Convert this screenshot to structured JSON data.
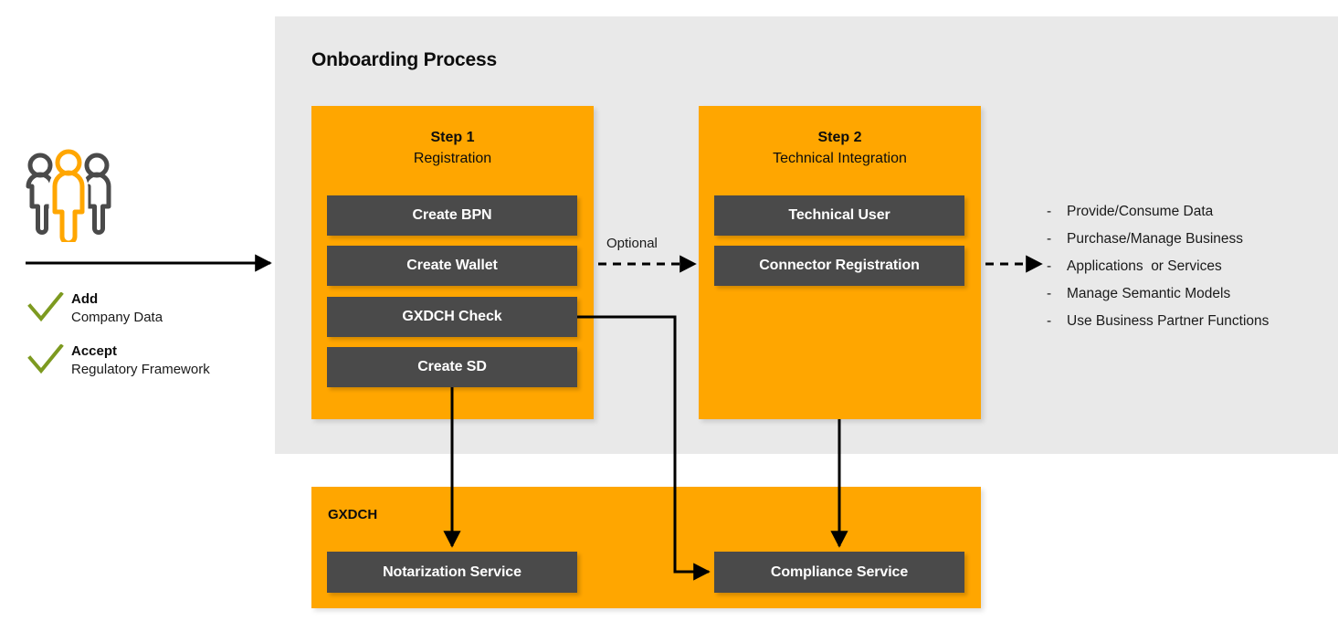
{
  "colors": {
    "panel_gray": "#e9e9e9",
    "orange": "#ffa600",
    "dark_button": "#4a4a4a",
    "check_green": "#7d9a20",
    "arrow_black": "#000000",
    "white": "#ffffff"
  },
  "panel": {
    "title": "Onboarding Process"
  },
  "actor": {
    "icon": "people-group-icon",
    "arrow": "actor-to-process-arrow",
    "checks": [
      {
        "icon": "check-icon",
        "title": "Add",
        "subtitle": "Company Data"
      },
      {
        "icon": "check-icon",
        "title": "Accept",
        "subtitle": "Regulatory Framework"
      }
    ]
  },
  "steps": [
    {
      "id": "step1",
      "title": "Step 1",
      "subtitle": "Registration",
      "buttons": [
        {
          "id": "create-bpn",
          "label": "Create BPN"
        },
        {
          "id": "create-wallet",
          "label": "Create Wallet"
        },
        {
          "id": "gxdch-check",
          "label": "GXDCH Check"
        },
        {
          "id": "create-sd",
          "label": "Create SD"
        }
      ]
    },
    {
      "id": "step2",
      "title": "Step 2",
      "subtitle": "Technical Integration",
      "buttons": [
        {
          "id": "technical-user",
          "label": "Technical User"
        },
        {
          "id": "connector-registration",
          "label": "Connector Registration"
        }
      ]
    }
  ],
  "connectors": {
    "optional_label": "Optional"
  },
  "gxdch": {
    "title": "GXDCH",
    "buttons": [
      {
        "id": "notarization-service",
        "label": "Notarization Service"
      },
      {
        "id": "compliance-service",
        "label": "Compliance Service"
      }
    ]
  },
  "capabilities": {
    "bullet": "-",
    "items": [
      "Provide/Consume Data",
      "Purchase/Manage Business",
      "Applications  or Services",
      "Manage Semantic Models",
      "Use Business Partner Functions"
    ]
  }
}
